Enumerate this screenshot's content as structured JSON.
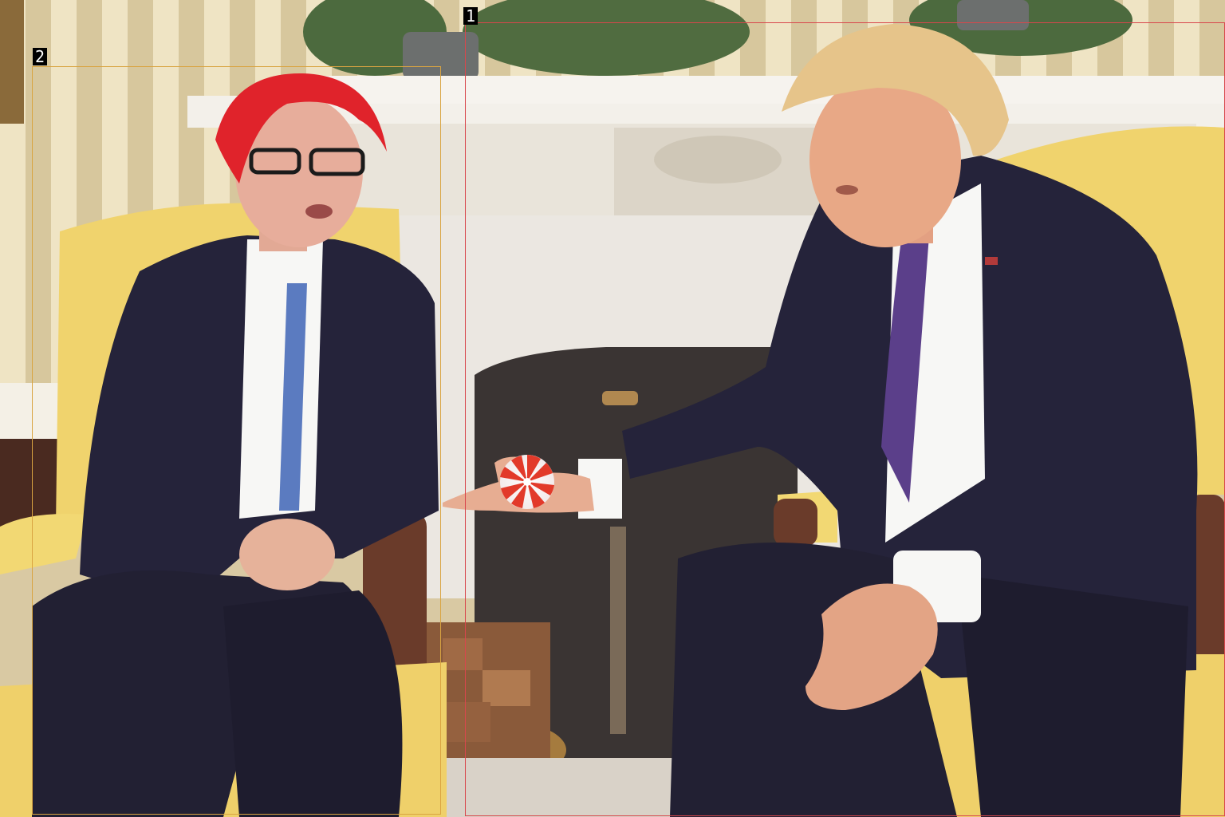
{
  "image": {
    "colors": {
      "wall_stripe_light": "#efe4c4",
      "wall_stripe_dark": "#d7c79d",
      "mantel": "#ece8df",
      "fireplace_screen": "#3a3433",
      "chair_yellow": "#f0d36d",
      "suit": "#25233a",
      "shirt": "#f7f7f5",
      "left_hair": "#e0232b",
      "right_hair": "#e6c48a",
      "right_tie": "#5b3f8a",
      "left_tie": "#5b7bc0",
      "candy_red": "#e23a2a"
    }
  },
  "annotations": [
    {
      "label": "1",
      "color": "#d8474c",
      "icon": "label-tag"
    },
    {
      "label": "2",
      "color": "#d9a441",
      "icon": "label-tag"
    }
  ]
}
